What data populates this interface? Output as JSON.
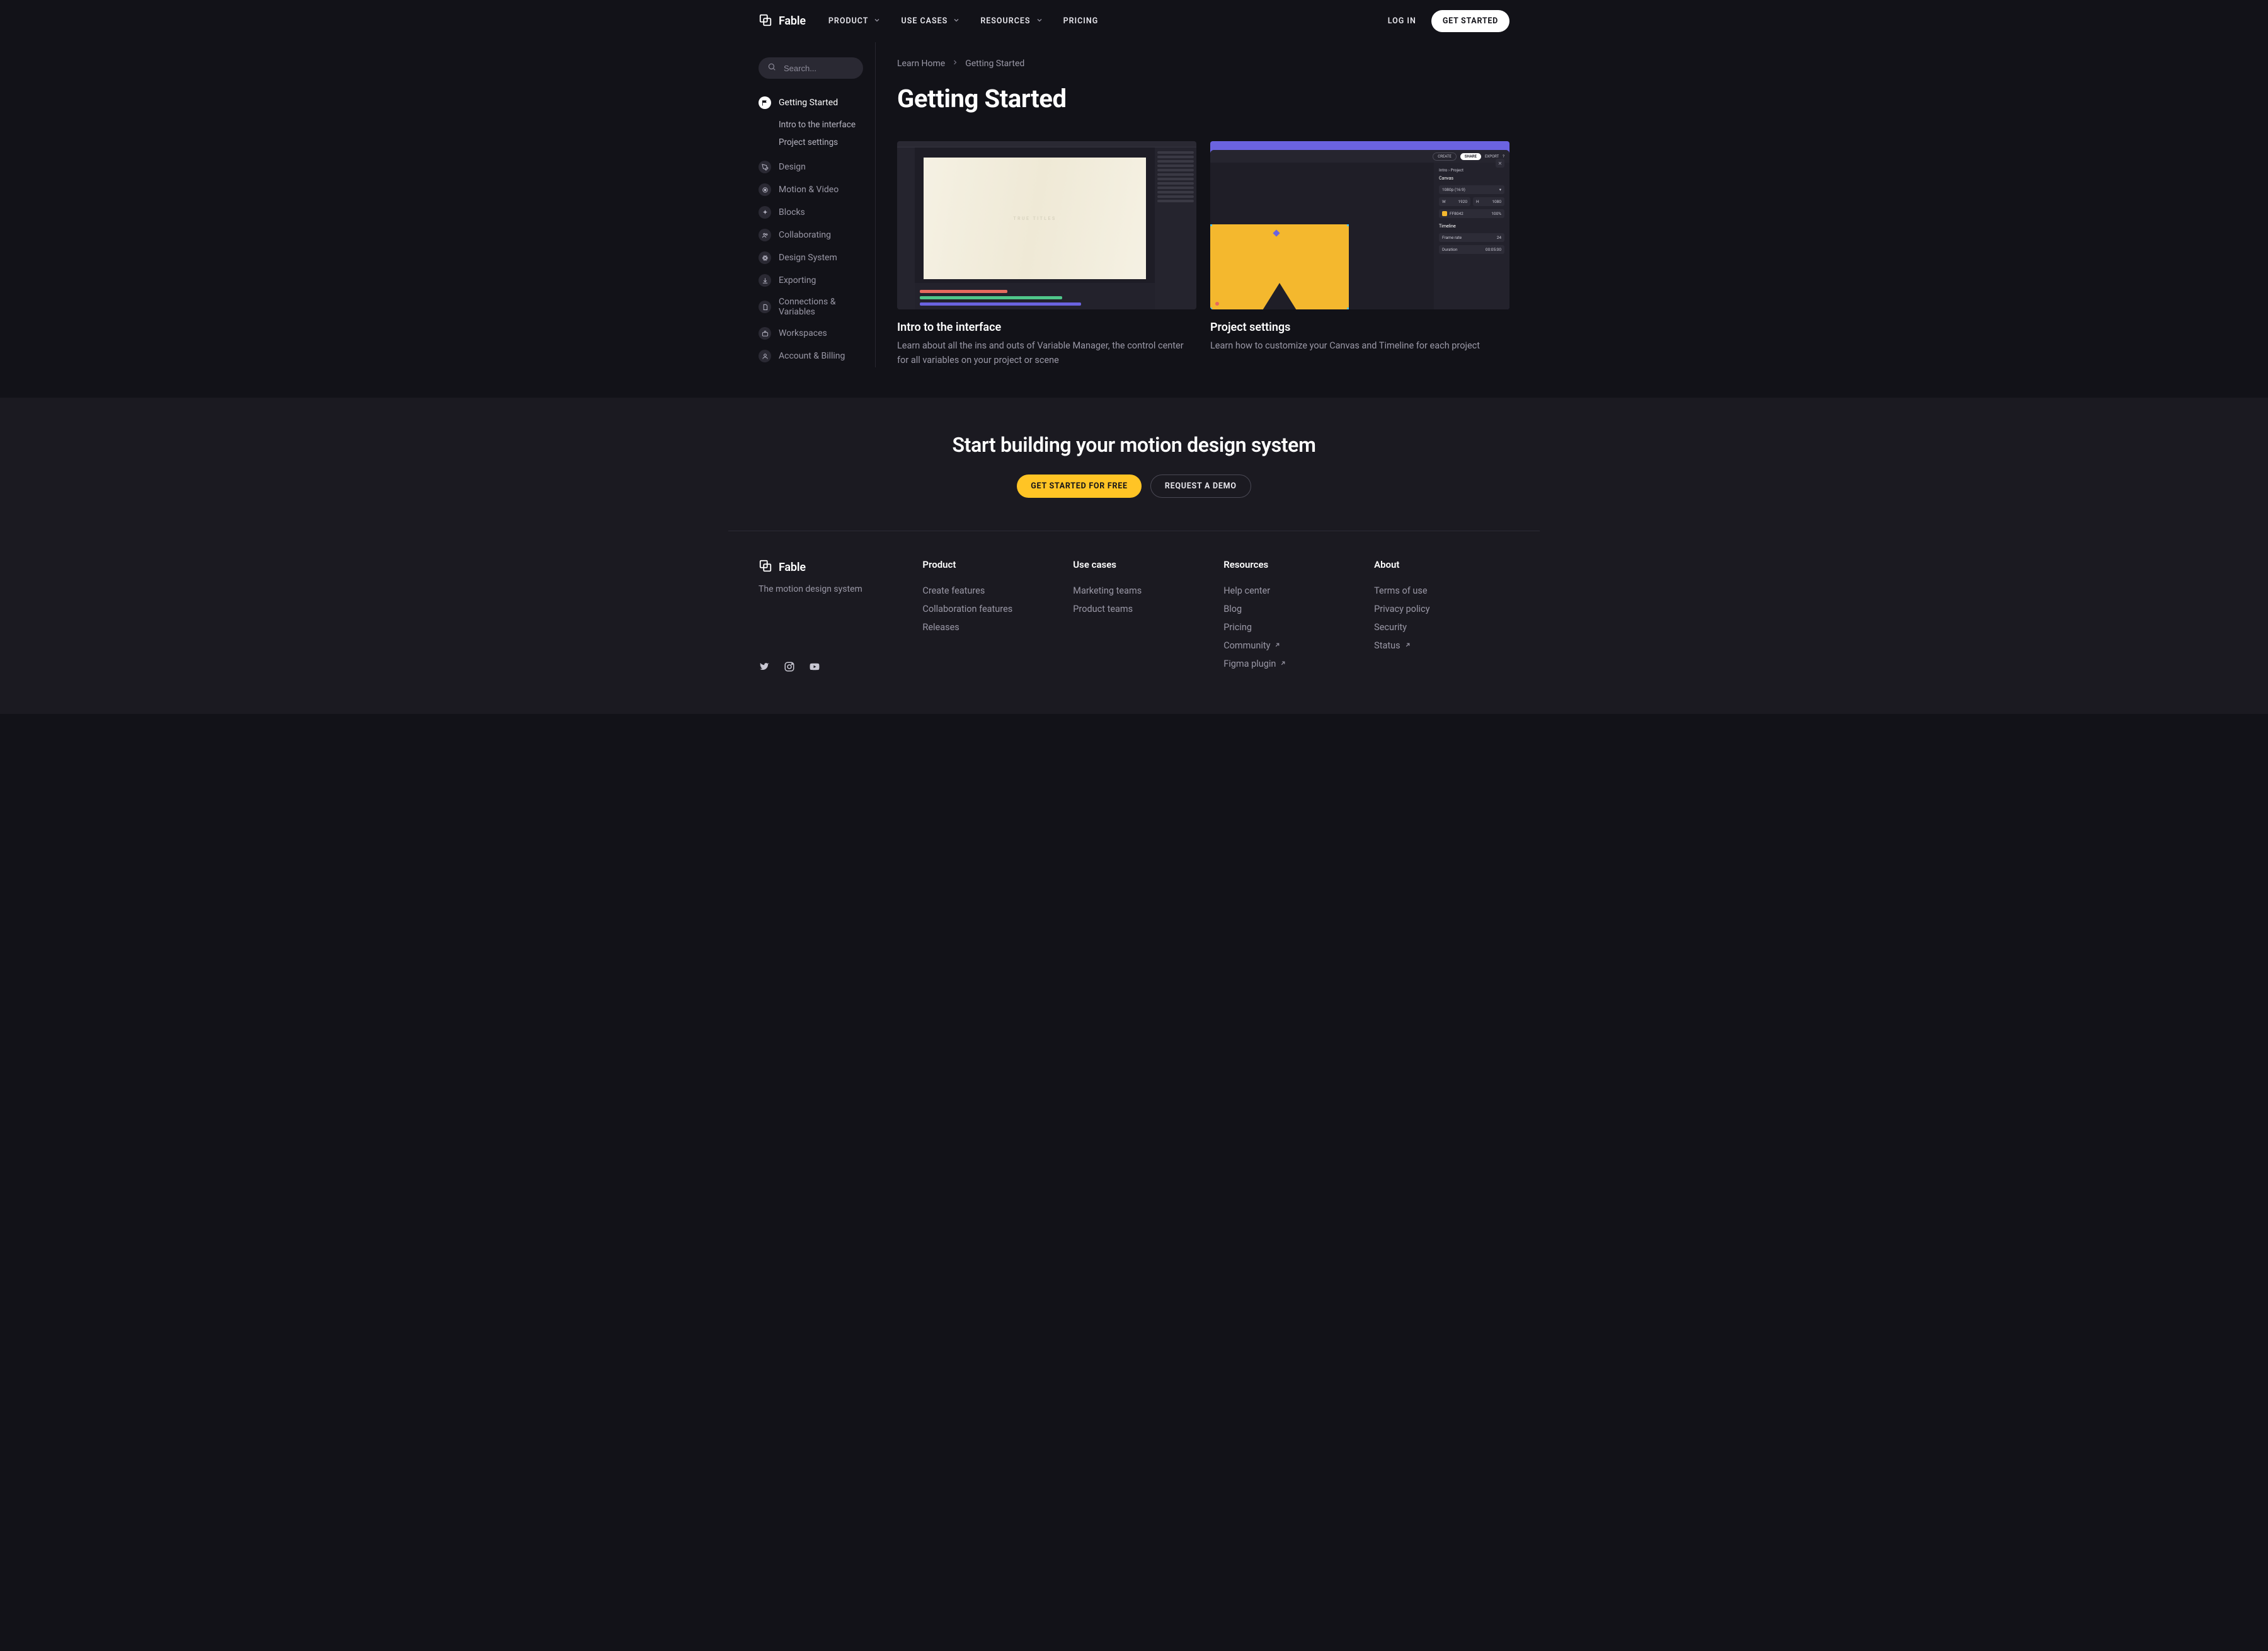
{
  "brand": {
    "name": "Fable",
    "tagline": "The motion design system"
  },
  "nav": {
    "items": [
      {
        "label": "PRODUCT"
      },
      {
        "label": "USE CASES"
      },
      {
        "label": "RESOURCES"
      },
      {
        "label": "PRICING"
      }
    ],
    "login": "LOG IN",
    "cta": "GET STARTED"
  },
  "search": {
    "placeholder": "Search..."
  },
  "sidebar": {
    "items": [
      {
        "label": "Getting Started",
        "active": true,
        "children": [
          "Intro to the interface",
          "Project settings"
        ]
      },
      {
        "label": "Design"
      },
      {
        "label": "Motion & Video"
      },
      {
        "label": "Blocks"
      },
      {
        "label": "Collaborating"
      },
      {
        "label": "Design System"
      },
      {
        "label": "Exporting"
      },
      {
        "label": "Connections & Variables"
      },
      {
        "label": "Workspaces"
      },
      {
        "label": "Account & Billing"
      }
    ]
  },
  "breadcrumb": {
    "root": "Learn Home",
    "current": "Getting Started"
  },
  "page": {
    "title": "Getting Started"
  },
  "cards": [
    {
      "title": "Intro to the interface",
      "desc": "Learn about all the ins and outs of Variable Manager, the control center for all variables on your project or scene",
      "thumb": {
        "canvas_text": "TRUE TITLES"
      }
    },
    {
      "title": "Project settings",
      "desc": "Learn how to customize your Canvas and Timeline for each project",
      "thumb": {
        "toolbar": {
          "create": "CREATE",
          "share": "SHARE",
          "export": "EXPORT"
        },
        "panel": {
          "crumb": "Intro › Project",
          "section_canvas": "Canvas",
          "preset": "1080p (16:9)",
          "w_label": "W",
          "w": "1920",
          "h_label": "H",
          "h": "1080",
          "color": "FF8042",
          "opacity": "100%",
          "section_timeline": "Timeline",
          "fps_label": "Frame rate",
          "fps": "24",
          "dur_label": "Duration",
          "dur": "00:05:00"
        }
      }
    }
  ],
  "cta": {
    "heading": "Start building your motion design system",
    "primary": "GET STARTED FOR FREE",
    "secondary": "REQUEST A DEMO"
  },
  "footer": {
    "cols": [
      {
        "title": "Product",
        "links": [
          "Create features",
          "Collaboration features",
          "Releases"
        ]
      },
      {
        "title": "Use cases",
        "links": [
          "Marketing teams",
          "Product teams"
        ]
      },
      {
        "title": "Resources",
        "links": [
          "Help center",
          "Blog",
          "Pricing",
          "Community",
          "Figma plugin"
        ],
        "external": [
          3,
          4
        ]
      },
      {
        "title": "About",
        "links": [
          "Terms of use",
          "Privacy policy",
          "Security",
          "Status"
        ],
        "external": [
          3
        ]
      }
    ]
  }
}
